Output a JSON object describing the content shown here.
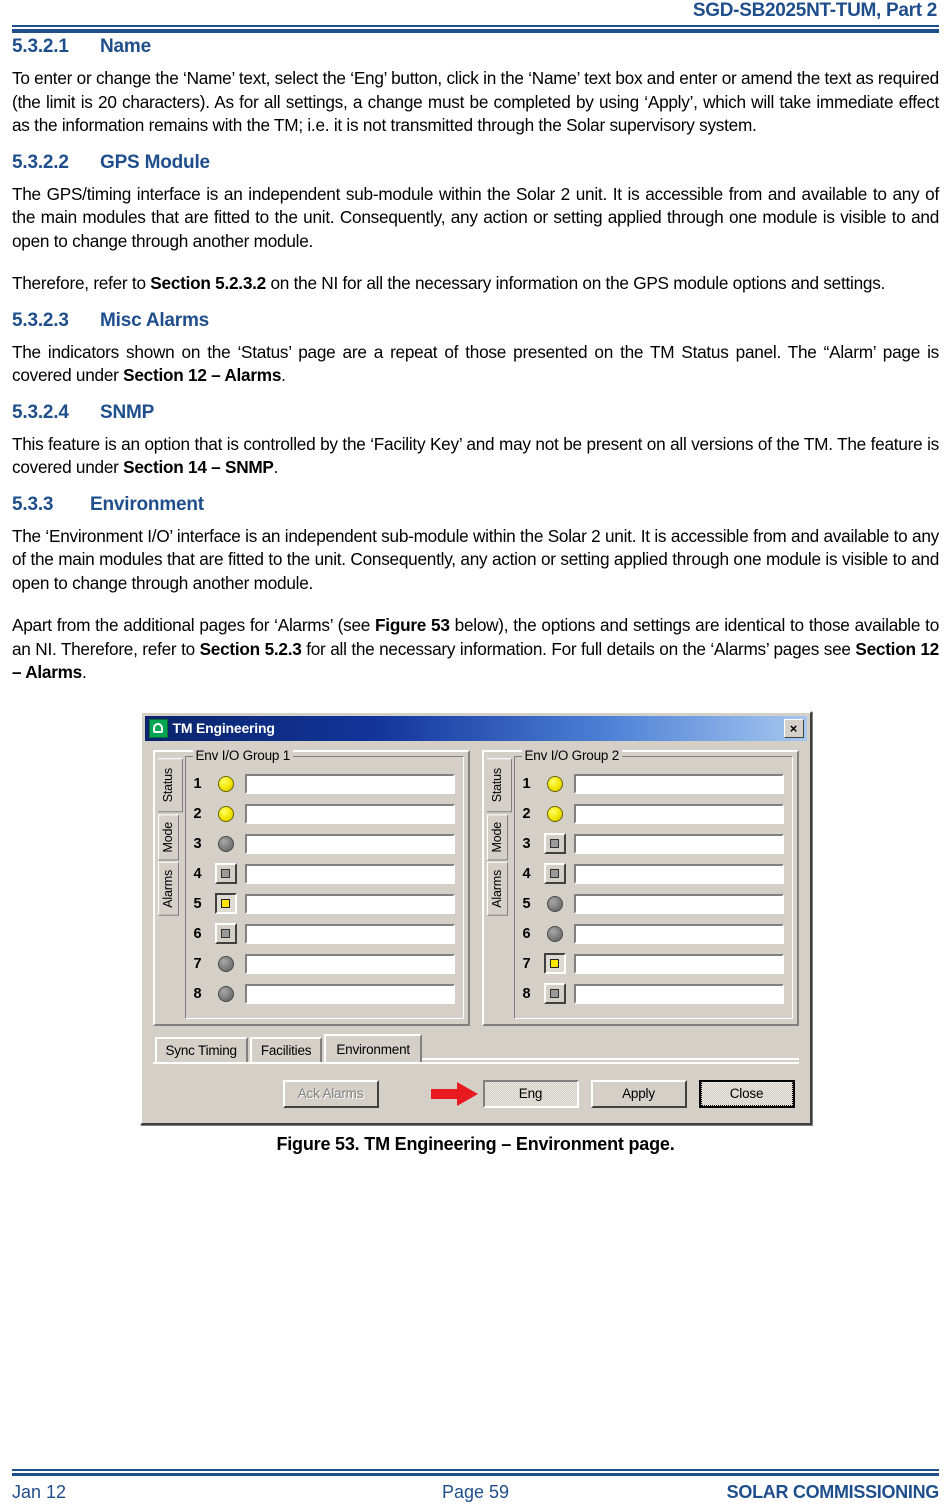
{
  "header": {
    "document_title": "SGD-SB2025NT-TUM, Part 2"
  },
  "sections": [
    {
      "number": "5.3.2.1",
      "title": "Name",
      "paragraphs": [
        "To enter or change the ‘Name’ text, select the ‘Eng’ button, click in the ‘Name’ text box and enter or amend the text as required (the limit is 20 characters).  As for all settings, a change must be completed by using ‘Apply’, which will take immediate effect as the information remains with the TM; i.e. it is not transmitted through the Solar supervisory system."
      ]
    },
    {
      "number": "5.3.2.2",
      "title": "GPS Module",
      "paragraphs": [
        "The GPS/timing interface is an independent sub-module within the Solar 2 unit.  It is accessible from and available to any of the main modules that are fitted to the unit.  Consequently, any action or setting applied through one module is visible to and open to change through another module."
      ],
      "paragraph2_parts": [
        {
          "text": "Therefore, refer to ",
          "bold": false
        },
        {
          "text": "Section 5.2.3.2",
          "bold": true
        },
        {
          "text": " on the NI for all the necessary information on the GPS module options and settings.",
          "bold": false
        }
      ]
    },
    {
      "number": "5.3.2.3",
      "title": "Misc Alarms",
      "paragraph_parts": [
        {
          "text": "The indicators shown on the ‘Status’ page are a repeat of those presented on the TM Status panel.  The “Alarm’ page is covered under ",
          "bold": false
        },
        {
          "text": "Section 12 – Alarms",
          "bold": true
        },
        {
          "text": ".",
          "bold": false
        }
      ]
    },
    {
      "number": "5.3.2.4",
      "title": "SNMP",
      "paragraph_parts": [
        {
          "text": "This feature is an option that is controlled by the ‘Facility Key’ and may not be present on all versions of the TM.  The feature is covered under ",
          "bold": false
        },
        {
          "text": "Section 14 – SNMP",
          "bold": true
        },
        {
          "text": ".",
          "bold": false
        }
      ]
    },
    {
      "number": "5.3.3",
      "title": "Environment",
      "paragraphs": [
        "The ‘Environment I/O’ interface is an independent sub-module within the Solar 2 unit.  It is accessible from and available to any of the main modules that are fitted to the unit.  Consequently, any action or setting applied through one module is visible to and open to change through another module."
      ],
      "paragraph2_parts": [
        {
          "text": "Apart from the additional pages for ‘Alarms’ (see ",
          "bold": false
        },
        {
          "text": "Figure 53",
          "bold": true
        },
        {
          "text": " below), the options and settings are identical to those available to an NI.  Therefore, refer to ",
          "bold": false
        },
        {
          "text": "Section 5.2.3",
          "bold": true
        },
        {
          "text": " for all the necessary information.  For full details on the ‘Alarms’ pages see ",
          "bold": false
        },
        {
          "text": "Section 12 – Alarms",
          "bold": true
        },
        {
          "text": ".",
          "bold": false
        }
      ]
    }
  ],
  "dialog": {
    "title": "TM Engineering",
    "icon": "tm-app-icon",
    "close_label": "×",
    "close_icon": "close-icon",
    "vertical_tabs": [
      "Status",
      "Mode",
      "Alarms"
    ],
    "vertical_tabs_active": "Status",
    "groups": [
      {
        "legend": "Env I/O Group 1",
        "rows": [
          {
            "num": "1",
            "indicator": "led",
            "state": "yellow",
            "value": ""
          },
          {
            "num": "2",
            "indicator": "led",
            "state": "yellow",
            "value": ""
          },
          {
            "num": "3",
            "indicator": "led",
            "state": "grey",
            "value": ""
          },
          {
            "num": "4",
            "indicator": "button",
            "state": "normal",
            "value": ""
          },
          {
            "num": "5",
            "indicator": "button",
            "state": "pressed",
            "value": ""
          },
          {
            "num": "6",
            "indicator": "button",
            "state": "normal",
            "value": ""
          },
          {
            "num": "7",
            "indicator": "led",
            "state": "grey",
            "value": ""
          },
          {
            "num": "8",
            "indicator": "led",
            "state": "grey",
            "value": ""
          }
        ]
      },
      {
        "legend": "Env I/O Group 2",
        "rows": [
          {
            "num": "1",
            "indicator": "led",
            "state": "yellow",
            "value": ""
          },
          {
            "num": "2",
            "indicator": "led",
            "state": "yellow",
            "value": ""
          },
          {
            "num": "3",
            "indicator": "button",
            "state": "normal",
            "value": ""
          },
          {
            "num": "4",
            "indicator": "button",
            "state": "normal",
            "value": ""
          },
          {
            "num": "5",
            "indicator": "led",
            "state": "grey",
            "value": ""
          },
          {
            "num": "6",
            "indicator": "led",
            "state": "grey",
            "value": ""
          },
          {
            "num": "7",
            "indicator": "button",
            "state": "pressed",
            "value": ""
          },
          {
            "num": "8",
            "indicator": "button",
            "state": "normal",
            "value": ""
          }
        ]
      }
    ],
    "bottom_tabs": [
      "Sync Timing",
      "Facilities",
      "Environment"
    ],
    "bottom_tabs_active": "Environment",
    "buttons": {
      "ack_alarms": "Ack Alarms",
      "eng": "Eng",
      "apply": "Apply",
      "close": "Close"
    },
    "annotation": {
      "arrow_icon": "red-arrow-icon",
      "arrow_color": "#e8191f",
      "points_to": "Eng"
    }
  },
  "figure": {
    "caption": "Figure 53.  TM Engineering – Environment page."
  },
  "footer": {
    "left": "Jan 12",
    "center": "Page 59",
    "right": "SOLAR COMMISSIONING"
  },
  "colors": {
    "heading_blue": "#1F4E8C",
    "dialog_face": "#d4d0c8",
    "led_yellow": "#f2e400",
    "led_grey": "#7d7d7d",
    "arrow_red": "#e8191f"
  }
}
